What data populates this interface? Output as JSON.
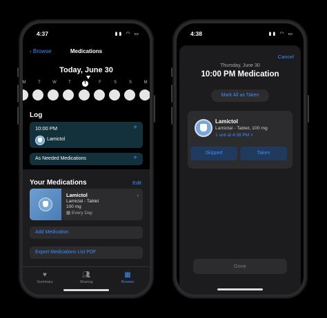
{
  "left": {
    "status": {
      "time": "4:37",
      "icons": "▮▮ ◠ ▭"
    },
    "nav": {
      "back": "Browse",
      "title": "Medications"
    },
    "date_title": "Today, June 30",
    "weekdays": [
      "M",
      "T",
      "W",
      "T",
      "F",
      "S",
      "S"
    ],
    "log": {
      "section": "Log",
      "time": "10:00 PM",
      "med_name": "Lamictol",
      "as_needed": "As Needed Medications"
    },
    "your_meds": {
      "section": "Your Medications",
      "edit": "Edit",
      "name": "Lamictol",
      "detail1": "Lamictal - Tablet",
      "detail2": "100 mg",
      "detail3": "Every Day"
    },
    "add_med": "Add Medication",
    "export": "Export Medications List PDF",
    "tabs": [
      {
        "label": "Summary",
        "icon": "heart-icon",
        "active": false
      },
      {
        "label": "Sharing",
        "icon": "people-icon",
        "active": false
      },
      {
        "label": "Browse",
        "icon": "grid-icon",
        "active": true
      }
    ]
  },
  "right": {
    "status": {
      "time": "4:38",
      "icons": "▮▮ ◠ ▭"
    },
    "cancel": "Cancel",
    "date": "Thursday, June 30",
    "title": "10:00 PM Medication",
    "mark_all": "Mark All as Taken",
    "med": {
      "name": "Lamictol",
      "detail": "Lamictal - Tablet, 100 mg",
      "units": "1 unit at 4:38 PM >"
    },
    "skipped": "Skipped",
    "taken": "Taken",
    "done": "Done"
  },
  "colors": {
    "accent": "#3f8cff",
    "background": "#000000",
    "card": "#1c1c1e"
  }
}
